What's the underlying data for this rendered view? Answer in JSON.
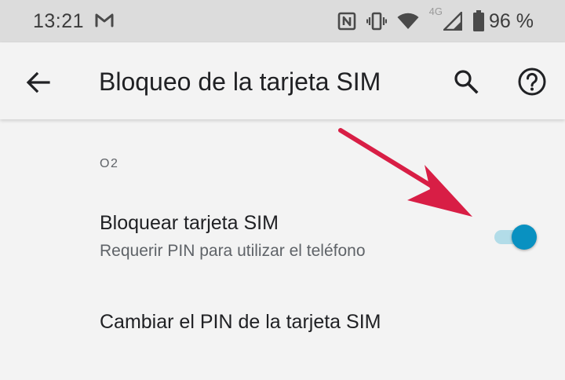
{
  "status_bar": {
    "time": "13:21",
    "notification_icon": "gmail-icon",
    "icons": [
      "nfc-icon",
      "vibrate-icon",
      "wifi-icon",
      "signal-4g-icon",
      "battery-icon"
    ],
    "network_type": "4G",
    "battery_percent": "96 %"
  },
  "app_bar": {
    "title": "Bloqueo de la tarjeta SIM",
    "back_icon": "arrow-back-icon",
    "search_icon": "search-icon",
    "help_icon": "help-icon"
  },
  "settings": {
    "carrier_header": "O2",
    "sim_lock": {
      "title": "Bloquear tarjeta SIM",
      "summary": "Requerir PIN para utilizar el teléfono",
      "enabled": true
    },
    "change_pin": {
      "title": "Cambiar el PIN de la tarjeta SIM"
    }
  },
  "colors": {
    "accent": "#0991c1",
    "switch_track": "#b2dce8",
    "annotation_arrow": "#d81e45",
    "status_bar_bg": "#dcdcdc",
    "page_bg": "#f3f3f3"
  }
}
